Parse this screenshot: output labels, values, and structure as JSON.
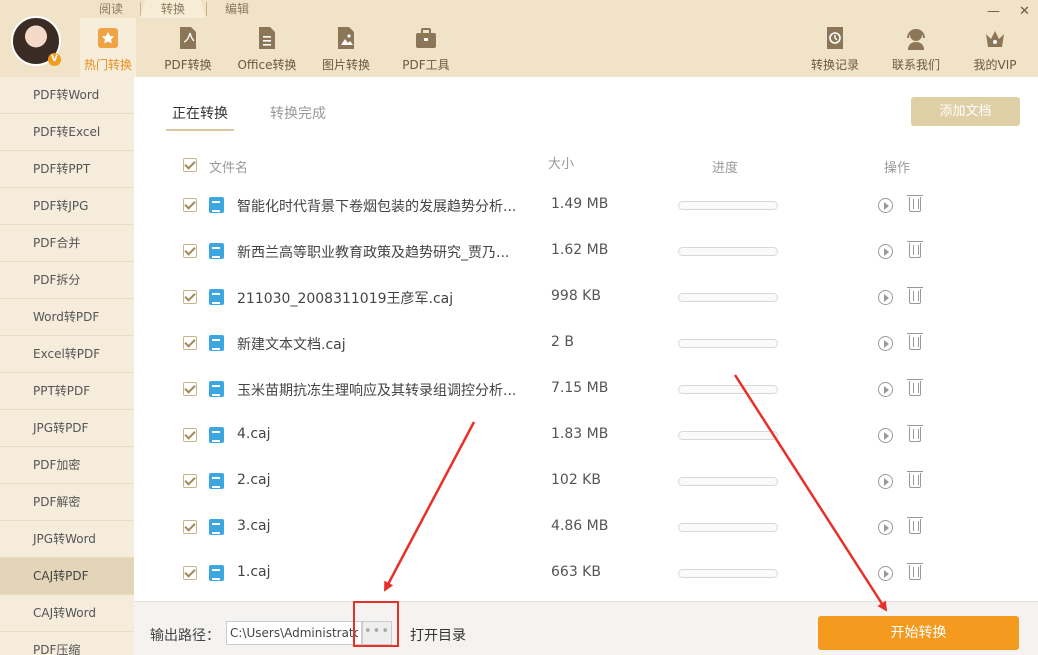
{
  "header": {
    "top_tabs": [
      "阅读",
      "转换",
      "编辑"
    ],
    "nav": [
      "热门转换",
      "PDF转换",
      "Office转换",
      "图片转换",
      "PDF工具"
    ],
    "right_nav": [
      "转换记录",
      "联系我们",
      "我的VIP"
    ],
    "vip_badge": "V",
    "window_buttons": [
      "—",
      "✕"
    ]
  },
  "sidebar": {
    "items": [
      "PDF转Word",
      "PDF转Excel",
      "PDF转PPT",
      "PDF转JPG",
      "PDF合并",
      "PDF拆分",
      "Word转PDF",
      "Excel转PDF",
      "PPT转PDF",
      "JPG转PDF",
      "PDF加密",
      "PDF解密",
      "JPG转Word",
      "CAJ转PDF",
      "CAJ转Word",
      "PDF压缩"
    ],
    "active": "CAJ转PDF"
  },
  "main": {
    "tabs": [
      "正在转换",
      "转换完成"
    ],
    "add_button": "添加文档",
    "columns": [
      "文件名",
      "大小",
      "进度",
      "操作"
    ],
    "files": [
      {
        "name": "智能化时代背景下卷烟包装的发展趋势分析...",
        "size": "1.49 MB",
        "progress": 0
      },
      {
        "name": "新西兰高等职业教育政策及趋势研究_贾乃...",
        "size": "1.62 MB",
        "progress": 0
      },
      {
        "name": "211030_2008311019王彦军.caj",
        "size": "998 KB",
        "progress": 0
      },
      {
        "name": "新建文本文档.caj",
        "size": "2 B",
        "progress": 0
      },
      {
        "name": "玉米苗期抗冻生理响应及其转录组调控分析...",
        "size": "7.15 MB",
        "progress": 0
      },
      {
        "name": "4.caj",
        "size": "1.83 MB",
        "progress": 0
      },
      {
        "name": "2.caj",
        "size": "102 KB",
        "progress": 0
      },
      {
        "name": "3.caj",
        "size": "4.86 MB",
        "progress": 0
      },
      {
        "name": "1.caj",
        "size": "663 KB",
        "progress": 0
      }
    ]
  },
  "footer": {
    "output_label": "输出路径：",
    "path_value": "C:\\Users\\Administrator",
    "browse": "•••",
    "open_dir": "打开目录",
    "start": "开始转换"
  },
  "colors": {
    "header_bg": "#f1e3c7",
    "accent": "#f39a1f",
    "annotation": "#e8302a"
  }
}
